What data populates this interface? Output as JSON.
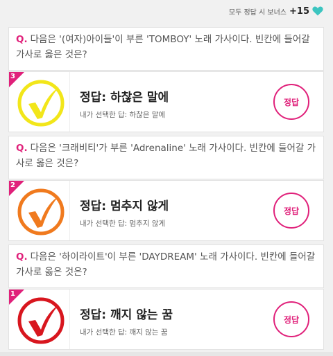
{
  "header": {
    "bonus_label": "모두 정답 시 보너스",
    "bonus_value": "+15",
    "heart_color": "#3cc5c0"
  },
  "accent_color": "#e0207a",
  "questions": [
    {
      "q_mark": "Q.",
      "question": "다음은 '(여자)아이들'이 부른 'TOMBOY' 노래 가사이다. 빈칸에 들어갈 가사로 옳은 것은?",
      "rank": "3",
      "check_color": "#f2e61a",
      "answer_label": "정답: 하찮은 말에",
      "selected_label": "내가 선택한 답: 하찮은 말에",
      "button_label": "정답"
    },
    {
      "q_mark": "Q.",
      "question": "다음은 '크래비티'가 부른 'Adrenaline' 노래 가사이다. 빈칸에 들어갈 가사로 옳은 것은?",
      "rank": "2",
      "check_color": "#f07a1e",
      "answer_label": "정답: 멈추지 않게",
      "selected_label": "내가 선택한 답: 멈추지 않게",
      "button_label": "정답"
    },
    {
      "q_mark": "Q.",
      "question": "다음은 '하이라이트'이 부른 'DAYDREAM' 노래 가사이다. 빈칸에 들어갈 가사로 옳은 것은?",
      "rank": "1",
      "check_color": "#d8161e",
      "answer_label": "정답: 깨지 않는 꿈",
      "selected_label": "내가 선택한 답: 깨지 않는 꿈",
      "button_label": "정답"
    }
  ]
}
